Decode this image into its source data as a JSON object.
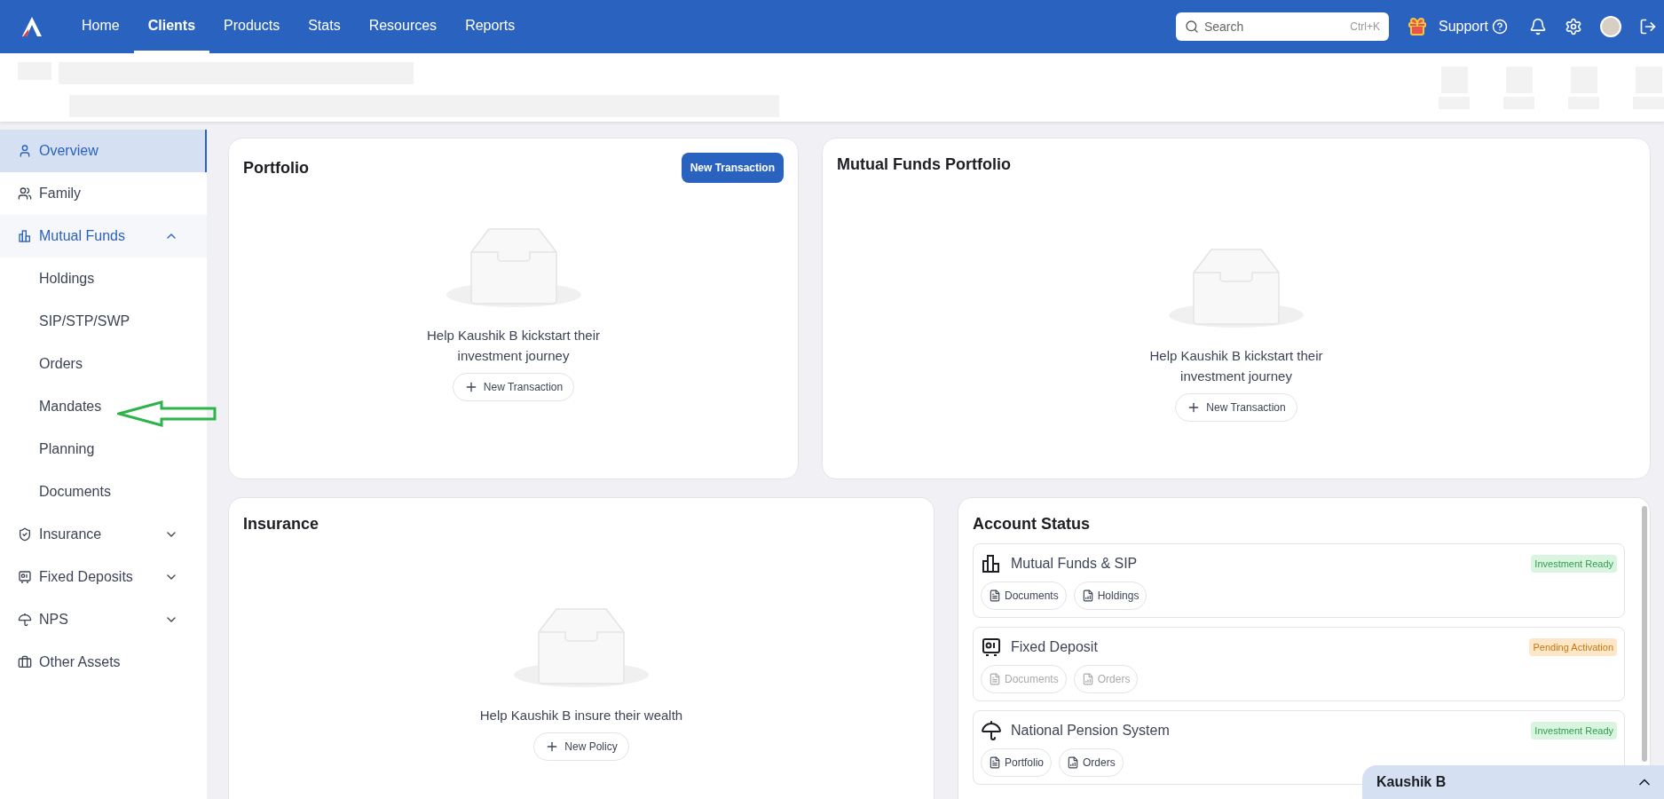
{
  "nav": {
    "items": [
      {
        "label": "Home",
        "selected": false
      },
      {
        "label": "Clients",
        "selected": true
      },
      {
        "label": "Products",
        "selected": false
      },
      {
        "label": "Stats",
        "selected": false
      },
      {
        "label": "Resources",
        "selected": false
      },
      {
        "label": "Reports",
        "selected": false
      }
    ]
  },
  "search": {
    "placeholder": "Search",
    "shortcut": "Ctrl+K"
  },
  "support": "Support",
  "sidebar": {
    "items": [
      {
        "label": "Overview",
        "selected": true
      },
      {
        "label": "Family",
        "selected": false
      },
      {
        "label": "Mutual Funds",
        "selected": false,
        "expanded": true,
        "children": [
          {
            "label": "Holdings",
            "selected": false
          },
          {
            "label": "SIP/STP/SWP",
            "selected": false
          },
          {
            "label": "Orders",
            "selected": false
          },
          {
            "label": "Mandates",
            "selected": false
          },
          {
            "label": "Planning",
            "selected": false
          },
          {
            "label": "Documents",
            "selected": false
          }
        ]
      },
      {
        "label": "Insurance",
        "selected": false,
        "expanded": false
      },
      {
        "label": "Fixed Deposits",
        "selected": false,
        "expanded": false
      },
      {
        "label": "NPS",
        "selected": false,
        "expanded": false
      },
      {
        "label": "Other Assets",
        "selected": false
      }
    ]
  },
  "portfolio": {
    "title": "Portfolio",
    "action": "New Transaction",
    "empty_text": "Help Kaushik B kickstart their investment journey",
    "empty_action": "New Transaction"
  },
  "mf_portfolio": {
    "title": "Mutual Funds Portfolio",
    "empty_text": "Help Kaushik B kickstart their investment journey",
    "empty_action": "New Transaction"
  },
  "insurance": {
    "title": "Insurance",
    "empty_text": "Help Kaushik B insure their wealth",
    "empty_action": "New Policy"
  },
  "account_status": {
    "title": "Account Status",
    "accounts": [
      {
        "name": "Mutual Funds & SIP",
        "status": "Investment Ready",
        "kind": "ready",
        "links": [
          {
            "label": "Documents",
            "disabled": false
          },
          {
            "label": "Holdings",
            "disabled": false
          }
        ]
      },
      {
        "name": "Fixed Deposit",
        "status": "Pending Activation",
        "kind": "pending",
        "links": [
          {
            "label": "Documents",
            "disabled": true
          },
          {
            "label": "Orders",
            "disabled": true
          }
        ]
      },
      {
        "name": "National Pension System",
        "status": "Investment Ready",
        "kind": "ready",
        "links": [
          {
            "label": "Portfolio",
            "disabled": false
          },
          {
            "label": "Orders",
            "disabled": false
          }
        ]
      }
    ]
  },
  "chat_panel": {
    "name": "Kaushik B"
  }
}
